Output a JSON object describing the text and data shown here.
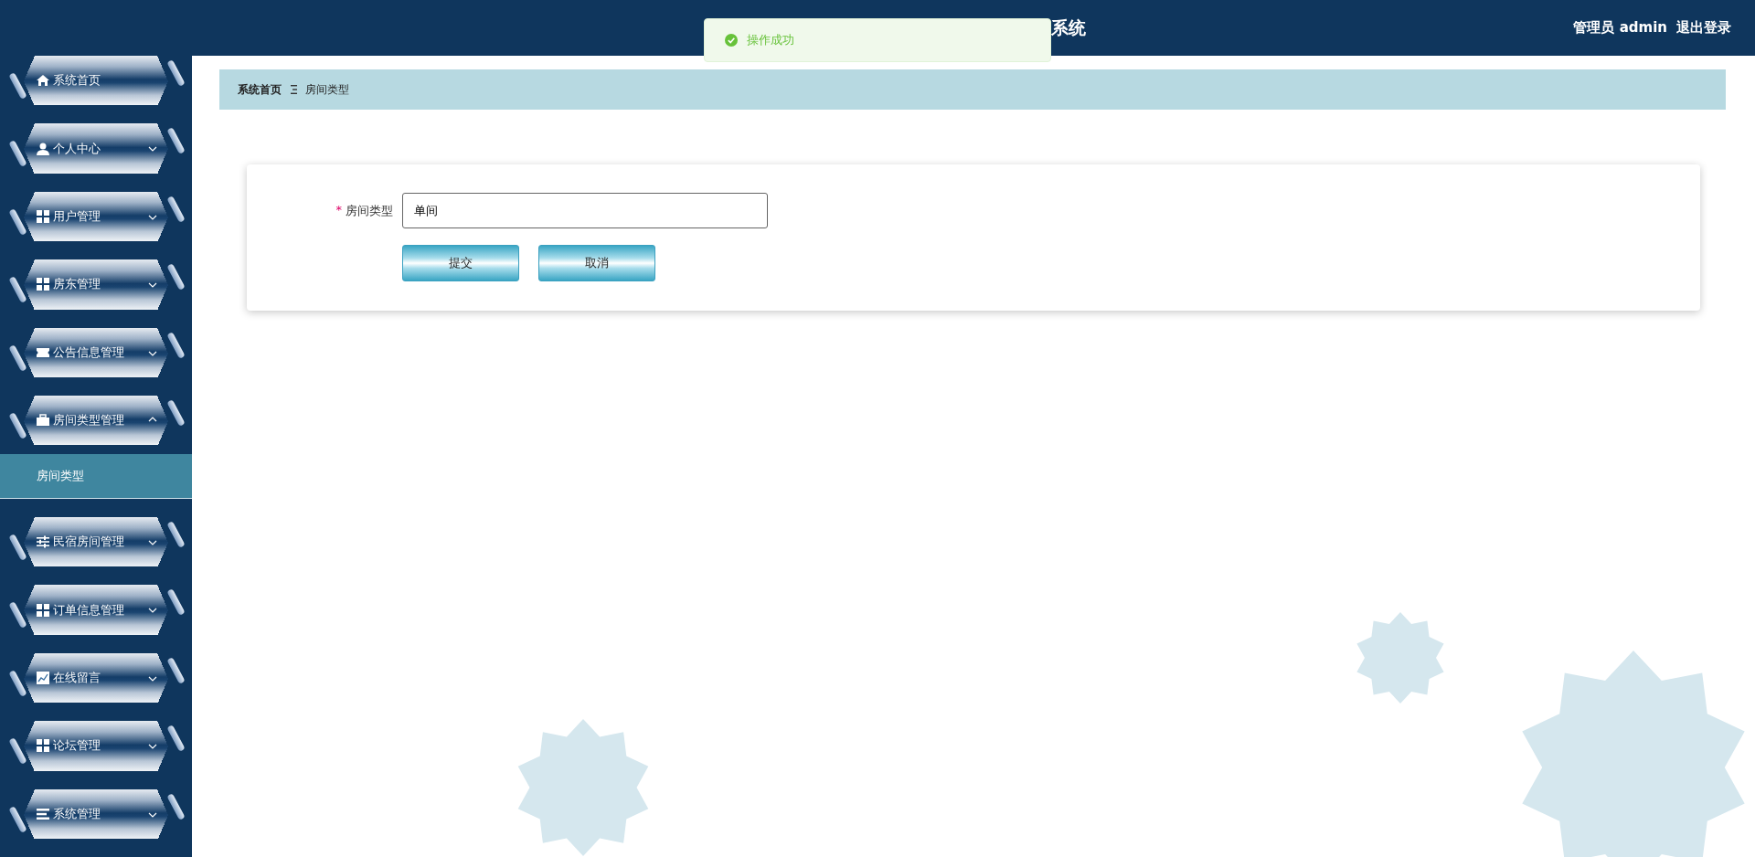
{
  "header": {
    "title": "系统",
    "user": "管理员 admin",
    "logout": "退出登录"
  },
  "toast": {
    "message": "操作成功"
  },
  "sidebar": {
    "items": [
      {
        "label": "系统首页",
        "kind": "link"
      },
      {
        "label": "个人中心",
        "kind": "submenu",
        "expanded": false
      },
      {
        "label": "用户管理",
        "kind": "submenu",
        "expanded": false
      },
      {
        "label": "房东管理",
        "kind": "submenu",
        "expanded": false
      },
      {
        "label": "公告信息管理",
        "kind": "submenu",
        "expanded": false
      },
      {
        "label": "房间类型管理",
        "kind": "submenu",
        "expanded": true,
        "children": [
          {
            "label": "房间类型",
            "selected": true
          }
        ]
      },
      {
        "label": "民宿房间管理",
        "kind": "submenu",
        "expanded": false
      },
      {
        "label": "订单信息管理",
        "kind": "submenu",
        "expanded": false
      },
      {
        "label": "在线留言",
        "kind": "submenu",
        "expanded": false
      },
      {
        "label": "论坛管理",
        "kind": "submenu",
        "expanded": false
      },
      {
        "label": "系统管理",
        "kind": "submenu",
        "expanded": false
      }
    ]
  },
  "breadcrumb": [
    "系统首页",
    "房间类型"
  ],
  "form": {
    "fields": [
      {
        "required_mark": "*",
        "label": "房间类型",
        "value": "单间"
      }
    ],
    "buttons": [
      "提交",
      "取消"
    ]
  }
}
